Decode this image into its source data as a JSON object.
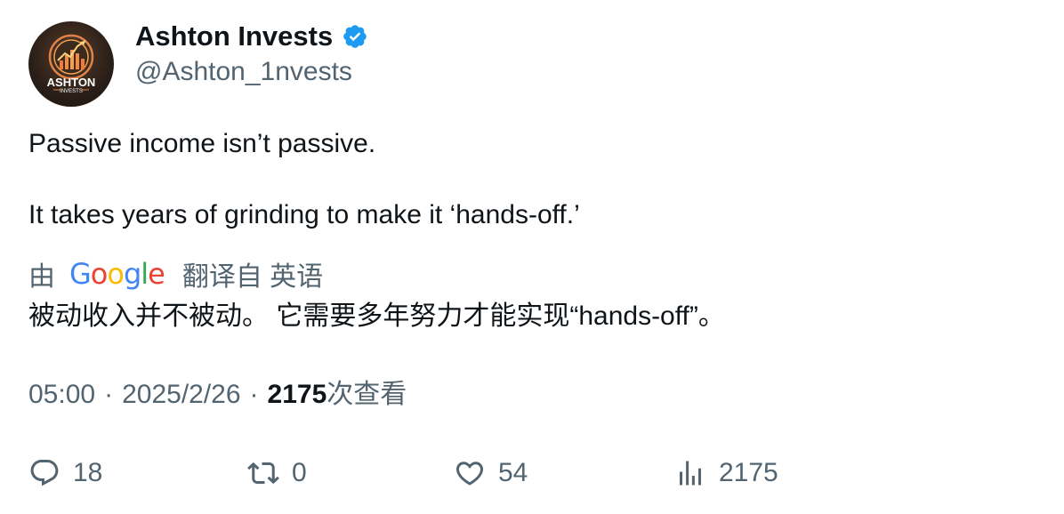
{
  "author": {
    "display_name": "Ashton Invests",
    "handle": "@Ashton_1nvests",
    "avatar_text_top": "ASHTON",
    "avatar_text_bottom": "INVESTS",
    "verified": true,
    "verified_color": "#1d9bf0"
  },
  "tweet": {
    "line1": "Passive income isn’t passive.",
    "line2": "It takes years of grinding to make it ‘hands-off.’"
  },
  "translation": {
    "by_label": "由",
    "provider": "Google",
    "translated_from": "翻译自 英语",
    "text": "被动收入并不被动。 它需要多年努力才能实现“hands-off”。"
  },
  "meta": {
    "time": "05:00",
    "date": "2025/2/26",
    "separator": "·",
    "views_count": "2175",
    "views_label": "次查看"
  },
  "actions": {
    "replies": "18",
    "retweets": "0",
    "likes": "54",
    "views": "2175"
  },
  "icons": {
    "reply": "reply-icon",
    "retweet": "retweet-icon",
    "like": "heart-icon",
    "views": "bar-chart-icon",
    "verified": "verified-badge-icon"
  }
}
